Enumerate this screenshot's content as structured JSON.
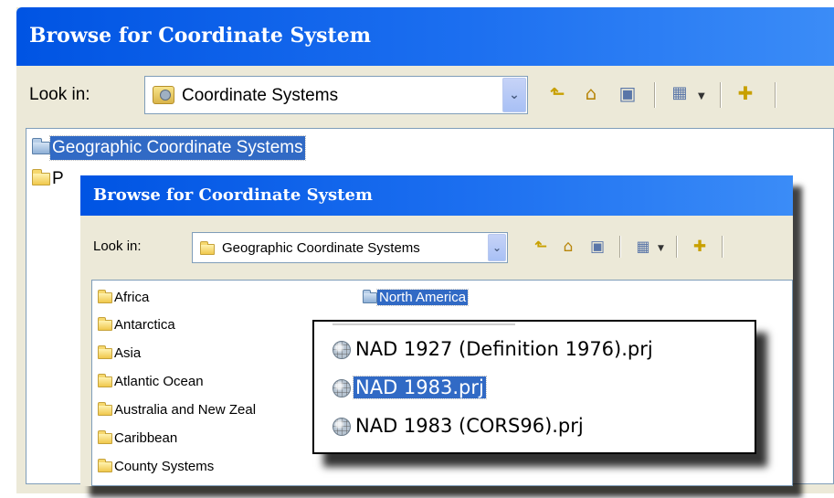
{
  "outer_dialog": {
    "title": "Browse for Coordinate System",
    "look_in_label": "Look in:",
    "look_in_value": "Coordinate Systems",
    "list_items": [
      {
        "label": "Geographic Coordinate Systems",
        "selected": true,
        "icon": "folder-blue-icon"
      },
      {
        "label": "P",
        "selected": false,
        "icon": "folder-icon"
      }
    ]
  },
  "inner_dialog": {
    "title": "Browse for Coordinate System",
    "look_in_label": "Look in:",
    "look_in_value": "Geographic Coordinate Systems",
    "list_col1": [
      {
        "label": "Africa"
      },
      {
        "label": "Antarctica"
      },
      {
        "label": "Asia"
      },
      {
        "label": "Atlantic Ocean"
      },
      {
        "label": "Australia and New Zeal"
      },
      {
        "label": "Caribbean"
      },
      {
        "label": "County Systems"
      }
    ],
    "list_col2": [
      {
        "label": "North America",
        "selected": true,
        "icon": "folder-blue-icon"
      }
    ]
  },
  "zoom_popup": {
    "items": [
      {
        "label": "NAD 1927 (Definition 1976).prj",
        "selected": false
      },
      {
        "label": "NAD 1983.prj",
        "selected": true
      },
      {
        "label": "NAD 1983 (CORS96).prj",
        "selected": false
      }
    ]
  },
  "toolbar_icons": [
    "up-one-level-icon",
    "home-icon",
    "connect-to-folder-icon",
    "view-menu-icon",
    "new-folder-icon"
  ],
  "colors": {
    "title_bar": "#0054e3",
    "selection": "#316ac5",
    "dialog_bg": "#ece9d8"
  }
}
